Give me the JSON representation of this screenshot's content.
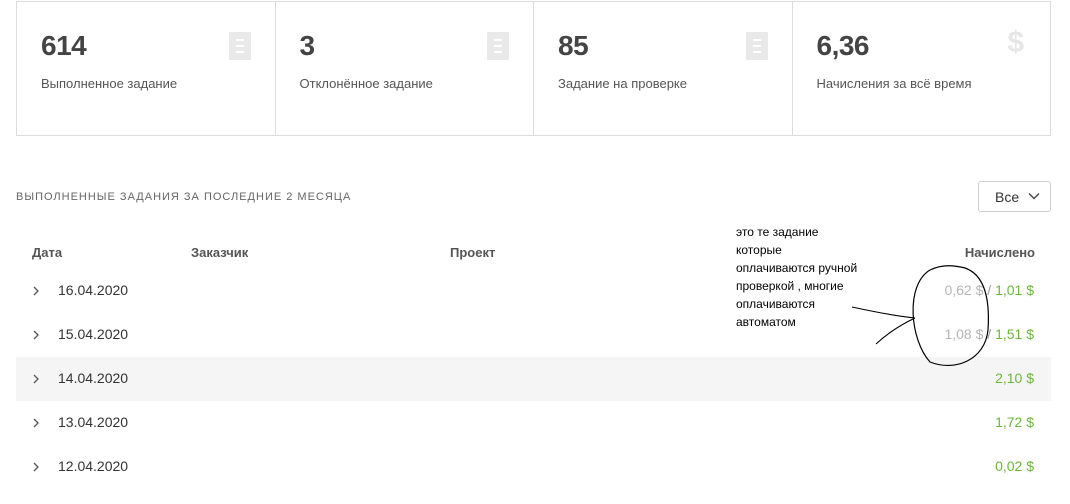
{
  "stats": [
    {
      "value": "614",
      "label": "Выполненное задание",
      "icon": "document-icon"
    },
    {
      "value": "3",
      "label": "Отклонённое задание",
      "icon": "document-icon"
    },
    {
      "value": "85",
      "label": "Задание на проверке",
      "icon": "document-icon"
    },
    {
      "value": "6,36",
      "label": "Начисления за всё время",
      "icon": "dollar-icon",
      "icon_glyph": "$"
    }
  ],
  "section": {
    "title": "ВЫПОЛНЕННЫЕ ЗАДАНИЯ ЗА ПОСЛЕДНИЕ 2 МЕСЯЦА",
    "filter_value": "Все"
  },
  "table": {
    "headers": {
      "date": "Дата",
      "customer": "Заказчик",
      "project": "Проект",
      "accrued": "Начислено"
    },
    "rows": [
      {
        "date": "16.04.2020",
        "pending": "0,62 $",
        "separator": " / ",
        "amount": "1,01 $",
        "highlighted": false
      },
      {
        "date": "15.04.2020",
        "pending": "1,08 $",
        "separator": " / ",
        "amount": "1,51 $",
        "highlighted": false
      },
      {
        "date": "14.04.2020",
        "pending": "",
        "separator": "",
        "amount": "2,10 $",
        "highlighted": true
      },
      {
        "date": "13.04.2020",
        "pending": "",
        "separator": "",
        "amount": "1,72 $",
        "highlighted": false
      },
      {
        "date": "12.04.2020",
        "pending": "",
        "separator": "",
        "amount": "0,02 $",
        "highlighted": false
      }
    ]
  },
  "annotation": {
    "lines": [
      "это те задание",
      "которые",
      "оплачиваются ручной",
      "проверкой , многие",
      "оплачиваются",
      "автоматом"
    ]
  },
  "colors": {
    "accent_green": "#6bb63c",
    "muted_grey": "#b5b5b5",
    "row_highlight": "#f5f5f5",
    "border": "#dcdcdc"
  }
}
